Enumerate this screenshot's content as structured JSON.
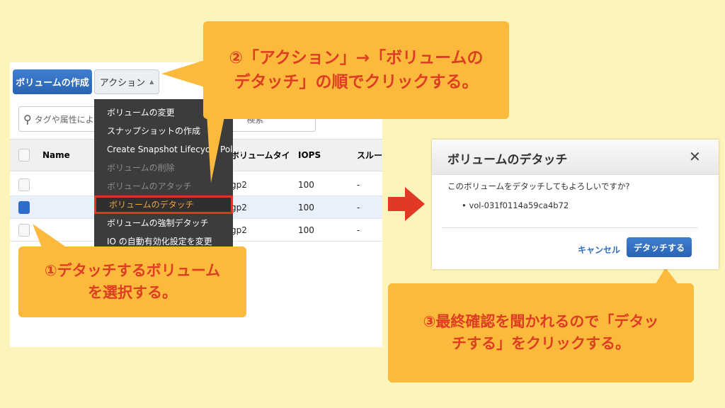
{
  "console": {
    "create_volume_button": "ボリュームの作成",
    "actions_button": "アクション",
    "search_placeholder": "タグや属性による",
    "search_suffix": "検索",
    "columns": [
      "Name",
      "ボリュームタイ",
      "IOPS",
      "スルー"
    ],
    "rows": [
      {
        "type": "gp2",
        "iops": "100",
        "throughput": "-",
        "selected": false
      },
      {
        "type": "gp2",
        "iops": "100",
        "throughput": "-",
        "selected": true
      },
      {
        "type": "gp2",
        "iops": "100",
        "throughput": "-",
        "selected": false
      }
    ],
    "action_menu": [
      {
        "label": "ボリュームの変更",
        "state": "enabled"
      },
      {
        "label": "スナップショットの作成",
        "state": "enabled"
      },
      {
        "label": "Create Snapshot Lifecycle Policy",
        "state": "enabled"
      },
      {
        "label": "ボリュームの削除",
        "state": "disabled"
      },
      {
        "label": "ボリュームのアタッチ",
        "state": "disabled"
      },
      {
        "label": "ボリュームのデタッチ",
        "state": "highlighted"
      },
      {
        "label": "ボリュームの強制デタッチ",
        "state": "enabled"
      },
      {
        "label": "IO の自動有効化設定を変更",
        "state": "enabled"
      }
    ]
  },
  "dialog": {
    "title": "ボリュームのデタッチ",
    "message": "このボリュームをデタッチしてもよろしいですか?",
    "volume_id": "vol-031f0114a59ca4b72",
    "cancel": "キャンセル",
    "confirm": "デタッチする"
  },
  "callouts": {
    "step1": "①デタッチするボリューム\nを選択する。",
    "step2": "②「アクション」→「ボリュームの\nデタッチ」の順でクリックする。",
    "step3": "③最終確認を聞かれるので「デタッ\nチする」をクリックする。"
  },
  "colors": {
    "background": "#fdf4bb",
    "callout": "#fbba3c",
    "callout_text": "#dd3d22",
    "arrow": "#e03a24",
    "primary": "#2a63b3"
  }
}
